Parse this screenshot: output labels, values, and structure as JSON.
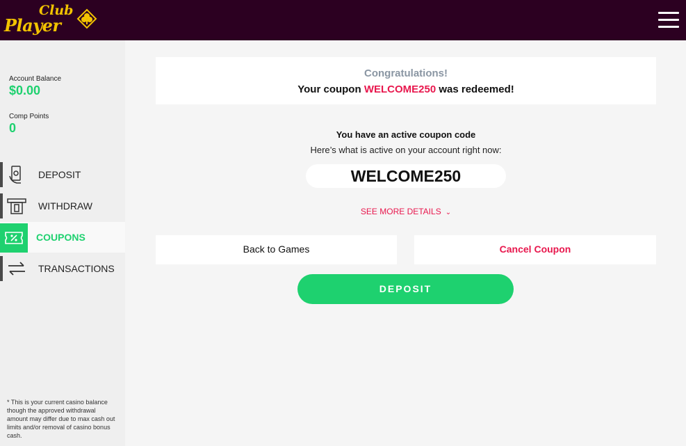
{
  "header": {
    "logo_top": "Club",
    "logo_bottom": "Player",
    "menu_icon": "hamburger-icon"
  },
  "account": {
    "balance_label": "Account Balance",
    "balance_value": "$0.00",
    "comp_label": "Comp Points",
    "comp_value": "0"
  },
  "nav": [
    {
      "label": "DEPOSIT",
      "icon": "money-hand-icon"
    },
    {
      "label": "WITHDRAW",
      "icon": "atm-icon"
    },
    {
      "label": "COUPONS",
      "icon": "coupon-icon",
      "active": true
    },
    {
      "label": "TRANSACTIONS",
      "icon": "arrows-exchange-icon"
    }
  ],
  "footnote": "* This is your current casino balance though the approved withdrawal amount may differ due to max cash out limits and/or removal of casino bonus cash.",
  "notice": {
    "title": "Congratulations!",
    "prefix": "Your coupon",
    "code": "WELCOME250",
    "suffix": "was redeemed!"
  },
  "active": {
    "title": "You have an active coupon code",
    "subtitle": "Here’s what is active on your account right now:",
    "code": "WELCOME250",
    "more": "SEE MORE DETAILS"
  },
  "buttons": {
    "back": "Back to Games",
    "cancel": "Cancel Coupon",
    "deposit": "DEPOSIT"
  },
  "colors": {
    "header_bg": "#2c0021",
    "accent_green": "#1ed16f",
    "accent_red": "#e8174d",
    "logo_gold": "#f2c300"
  }
}
